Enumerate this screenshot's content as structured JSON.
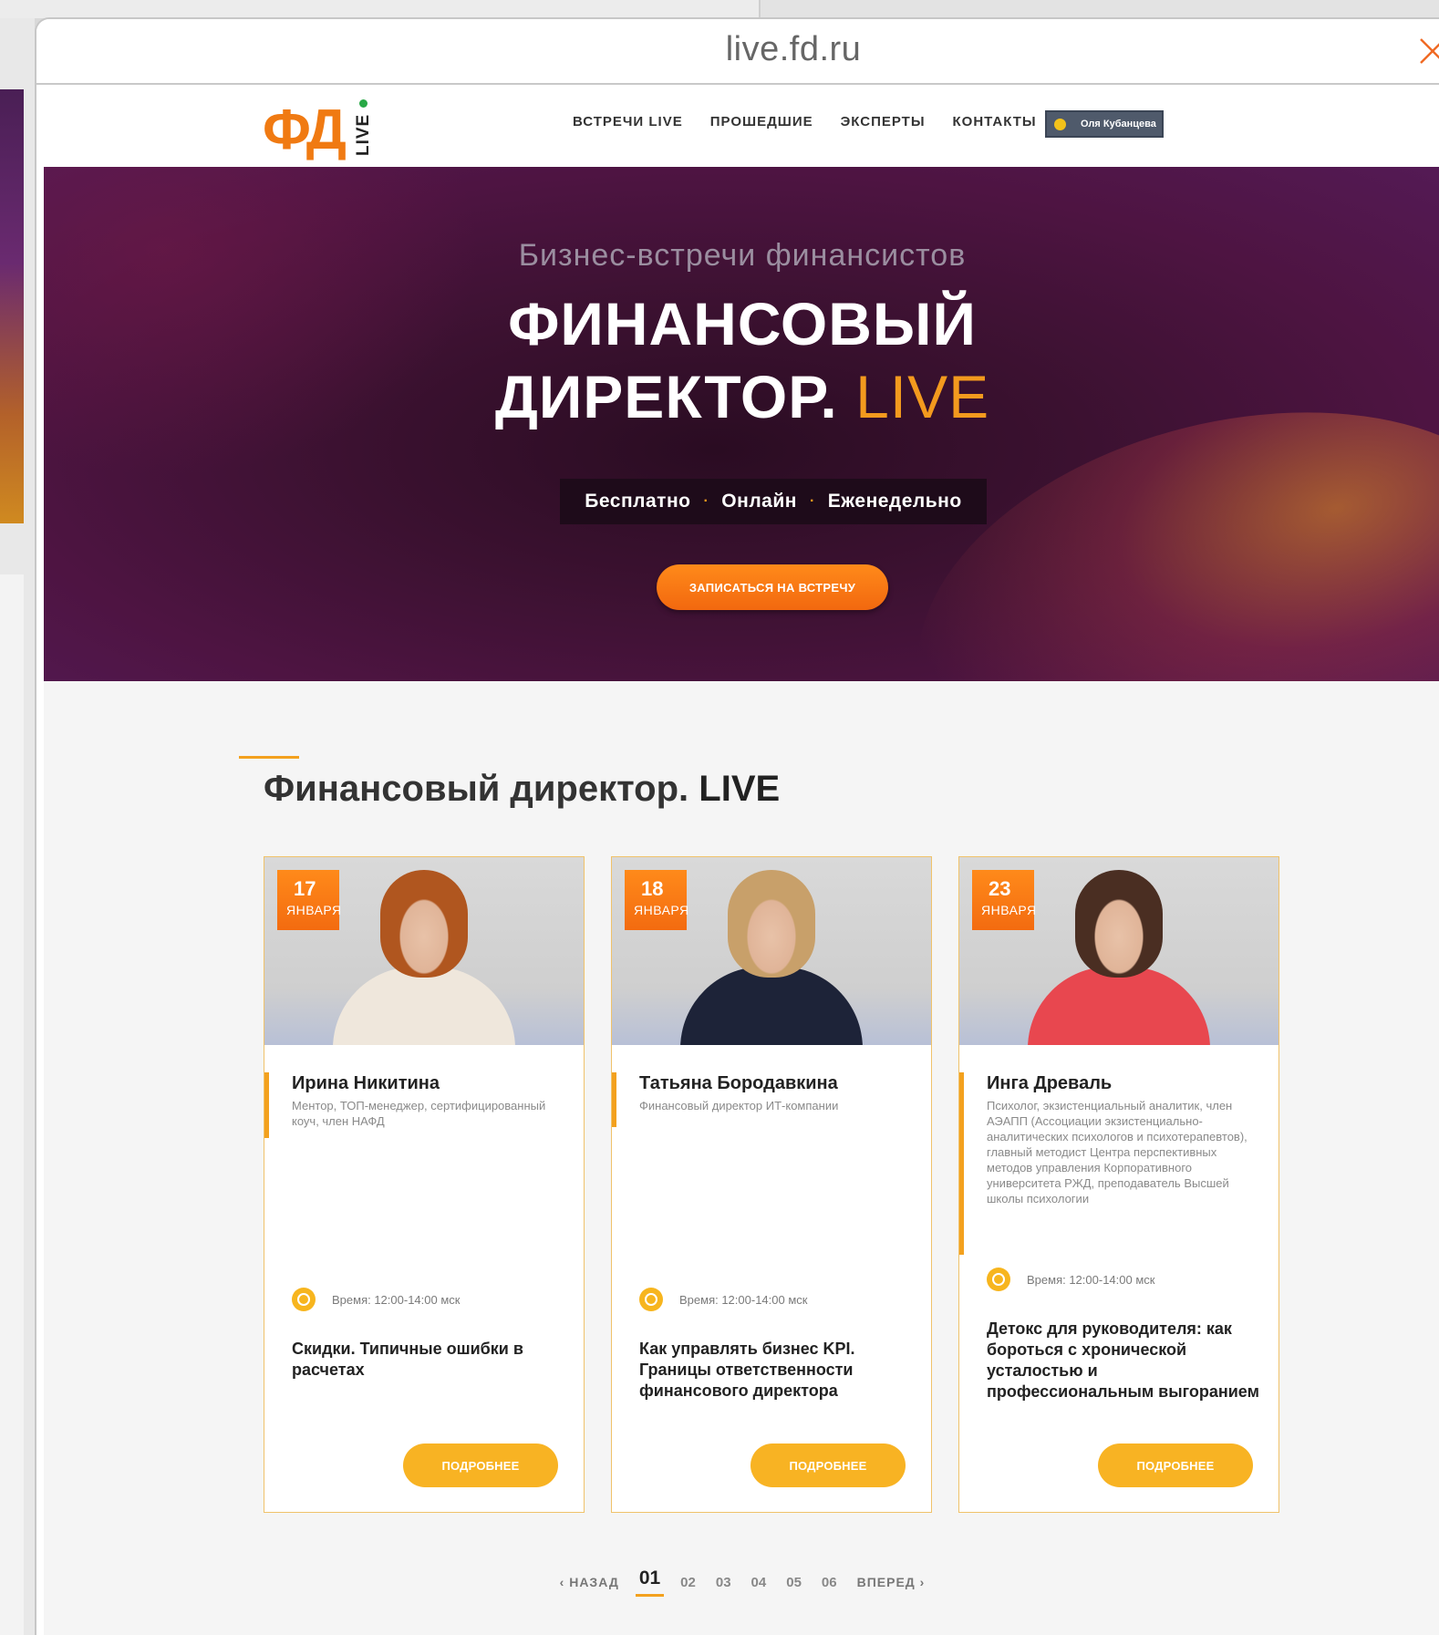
{
  "browser": {
    "url": "live.fd.ru"
  },
  "header": {
    "logo_main": "ФД",
    "logo_sub": "LIVE",
    "nav": [
      "ВСТРЕЧИ LIVE",
      "ПРОШЕДШИЕ",
      "ЭКСПЕРТЫ",
      "КОНТАКТЫ"
    ],
    "user_name": "Оля Кубанцева"
  },
  "hero": {
    "subtitle": "Бизнес-встречи финансистов",
    "title_line1": "ФИНАНСОВЫЙ",
    "title_line2": "ДИРЕКТОР.",
    "title_accent": "LIVE",
    "tags": [
      "Бесплатно",
      "Онлайн",
      "Еженедельно"
    ],
    "tag_separator": "·",
    "cta": "ЗАПИСАТЬСЯ НА ВСТРЕЧУ"
  },
  "section": {
    "title": "Финансовый директор.",
    "title_bold": "LIVE"
  },
  "cards": [
    {
      "day": "17",
      "month": "ЯНВАРЯ",
      "name": "Ирина Никитина",
      "role": "Ментор, ТОП-менеджер, сертифицированный коуч, член НАФД",
      "time": "Время: 12:00-14:00 мск",
      "topic": "Скидки. Типичные ошибки в расчетах",
      "button": "ПОДРОБНЕЕ",
      "hair": "#b0561f",
      "top": "#efe7dc"
    },
    {
      "day": "18",
      "month": "ЯНВАРЯ",
      "name": "Татьяна Бородавкина",
      "role": "Финансовый директор ИТ-компании",
      "time": "Время: 12:00-14:00 мск",
      "topic": "Как управлять бизнес KPI. Границы ответственности финансового директора",
      "button": "ПОДРОБНЕЕ",
      "hair": "#c8a06a",
      "top": "#1d2338"
    },
    {
      "day": "23",
      "month": "ЯНВАРЯ",
      "name": "Инга Древаль",
      "role": "Психолог, экзистенциальный аналитик, член АЭАПП (Ассоциации экзистенциально-аналитических психологов и психотерапевтов), главный методист Центра перспективных методов управления Корпоративного университета РЖД, преподаватель Высшей школы психологии",
      "time": "Время: 12:00-14:00 мск",
      "topic": "Детокс для руководителя: как бороться с хронической усталостью и профессиональным выгоранием",
      "button": "ПОДРОБНЕЕ",
      "hair": "#4a2e22",
      "top": "#e8474f"
    }
  ],
  "pagination": {
    "prev": "НАЗАД",
    "next": "ВПЕРЕД",
    "pages": [
      "01",
      "02",
      "03",
      "04",
      "05",
      "06"
    ],
    "current": "01"
  },
  "colors": {
    "accent_orange": "#f39a1e",
    "card_border": "#f0c26a",
    "button_yellow": "#f8b323",
    "user_button": "#4f5a6b"
  }
}
